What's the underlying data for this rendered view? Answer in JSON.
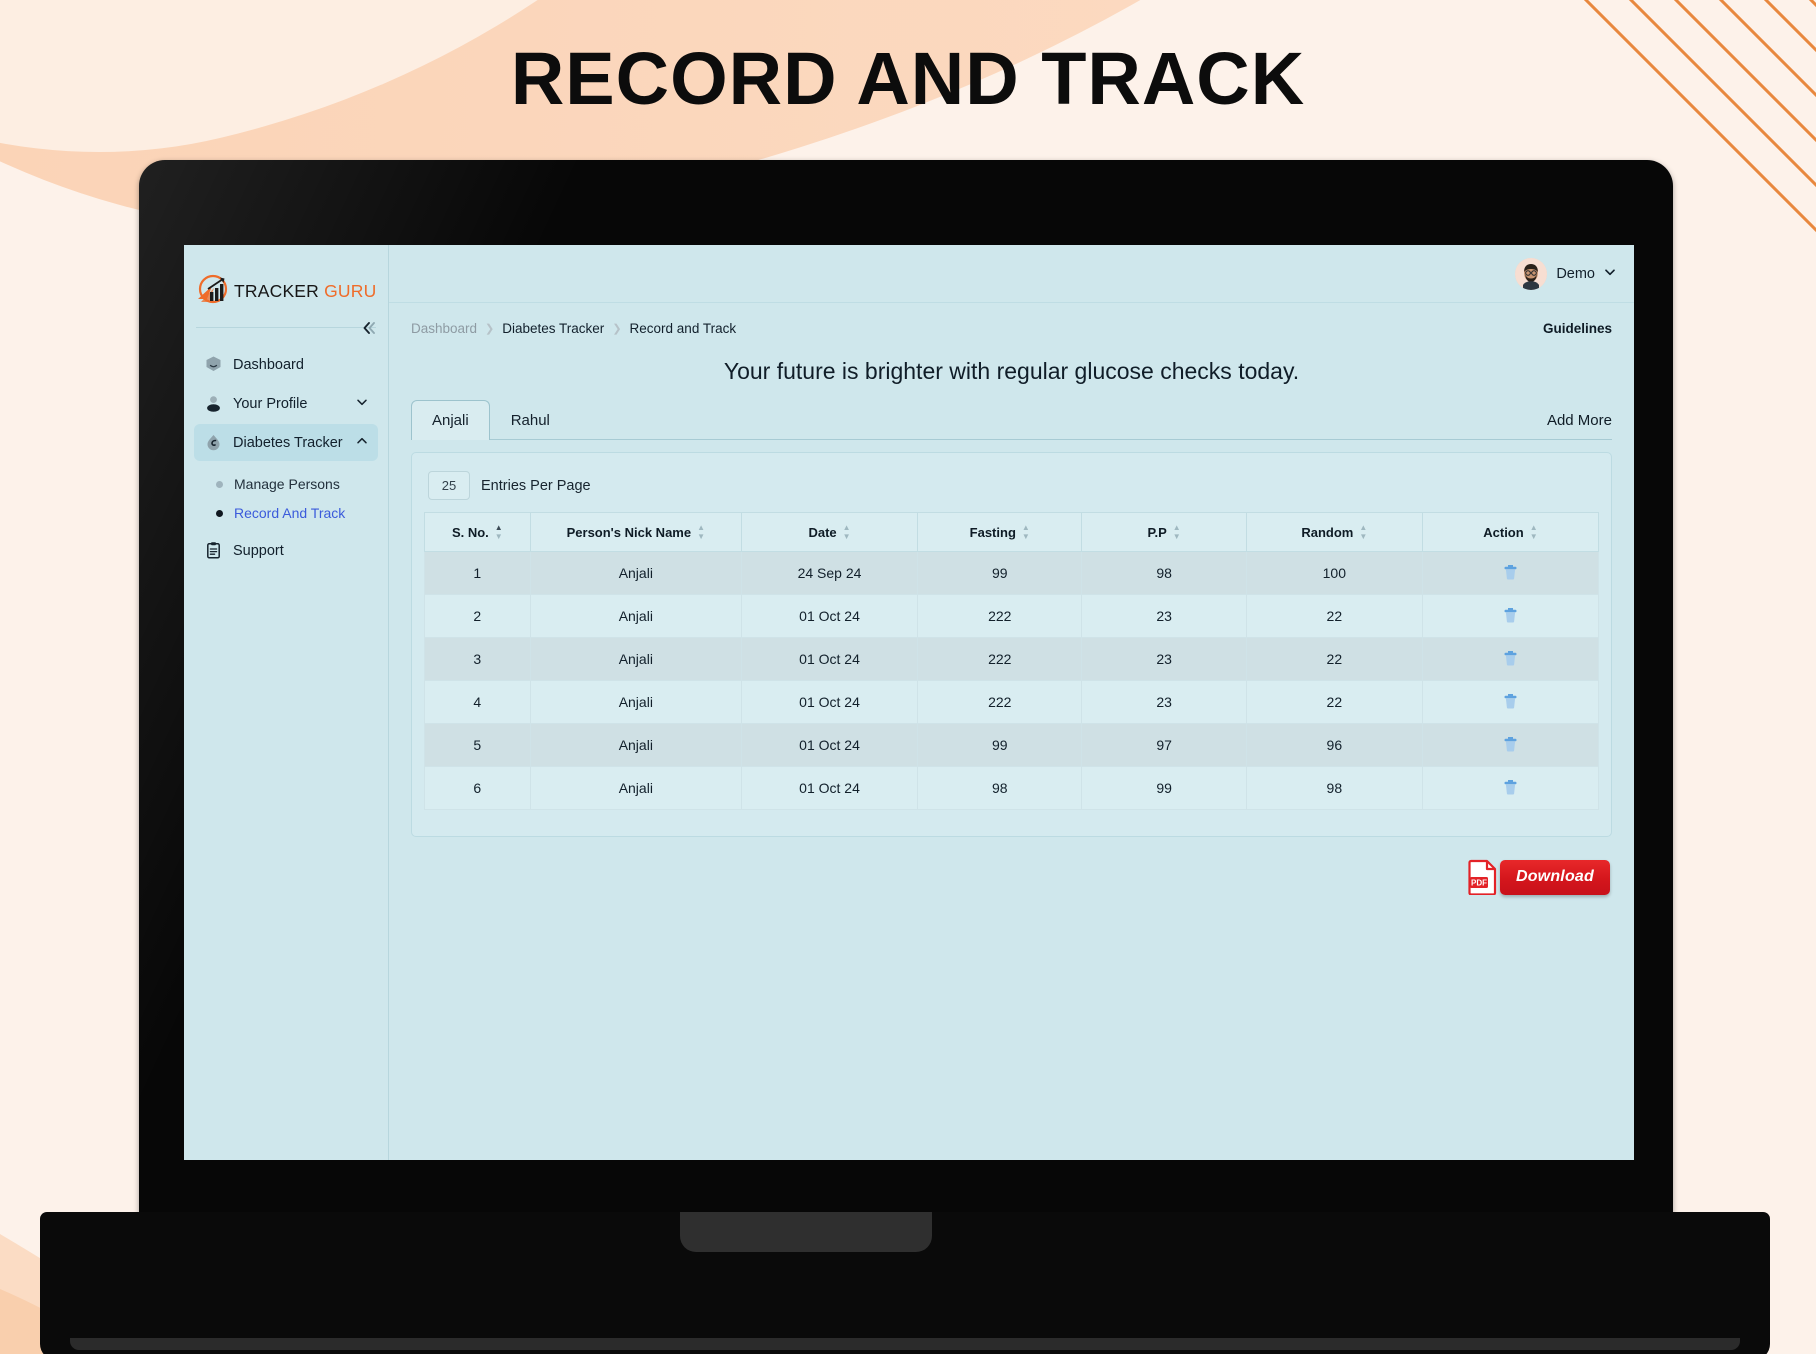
{
  "page": {
    "title": "RECORD AND TRACK"
  },
  "brand": {
    "name": "TRACKER",
    "accent": "GURU",
    "logo_icon": "chart-arrow-logo-icon"
  },
  "sidebar": {
    "collapse_icon": "double-chevron-left-icon",
    "items": [
      {
        "label": "Dashboard",
        "icon": "dashboard-icon",
        "caret": "",
        "active": false
      },
      {
        "label": "Your Profile",
        "icon": "user-icon",
        "caret": "⌄",
        "active": false
      },
      {
        "label": "Diabetes Tracker",
        "icon": "droplet-icon",
        "caret": "⌃",
        "active": true
      },
      {
        "label": "Support",
        "icon": "clipboard-icon",
        "caret": "",
        "active": false
      }
    ],
    "subitems": [
      {
        "label": "Manage Persons",
        "selected": false
      },
      {
        "label": "Record And Track",
        "selected": true
      }
    ]
  },
  "topbar": {
    "user_name": "Demo",
    "caret_icon": "chevron-down-icon",
    "avatar_icon": "avatar-bearded-man-icon"
  },
  "breadcrumb": {
    "items": [
      "Dashboard",
      "Diabetes Tracker",
      "Record and Track"
    ],
    "separator": "❯"
  },
  "guidelines_label": "Guidelines",
  "headline": "Your future is brighter with regular glucose checks today.",
  "tabs": [
    {
      "label": "Anjali",
      "active": true
    },
    {
      "label": "Rahul",
      "active": false
    }
  ],
  "add_more_label": "Add More",
  "entries": {
    "value": "25",
    "label": "Entries Per Page"
  },
  "table": {
    "columns": [
      {
        "label": "S. No.",
        "sort": "asc"
      },
      {
        "label": "Person's Nick Name",
        "sort": "none"
      },
      {
        "label": "Date",
        "sort": "none"
      },
      {
        "label": "Fasting",
        "sort": "none"
      },
      {
        "label": "P.P",
        "sort": "none"
      },
      {
        "label": "Random",
        "sort": "none"
      },
      {
        "label": "Action",
        "sort": "none"
      }
    ],
    "rows": [
      {
        "sno": "1",
        "name": "Anjali",
        "date": "24 Sep 24",
        "fasting": "99",
        "pp": "98",
        "random": "100",
        "action_icon": "trash-icon"
      },
      {
        "sno": "2",
        "name": "Anjali",
        "date": "01 Oct 24",
        "fasting": "222",
        "pp": "23",
        "random": "22",
        "action_icon": "trash-icon"
      },
      {
        "sno": "3",
        "name": "Anjali",
        "date": "01 Oct 24",
        "fasting": "222",
        "pp": "23",
        "random": "22",
        "action_icon": "trash-icon"
      },
      {
        "sno": "4",
        "name": "Anjali",
        "date": "01 Oct 24",
        "fasting": "222",
        "pp": "23",
        "random": "22",
        "action_icon": "trash-icon"
      },
      {
        "sno": "5",
        "name": "Anjali",
        "date": "01 Oct 24",
        "fasting": "99",
        "pp": "97",
        "random": "96",
        "action_icon": "trash-icon"
      },
      {
        "sno": "6",
        "name": "Anjali",
        "date": "01 Oct 24",
        "fasting": "98",
        "pp": "99",
        "random": "98",
        "action_icon": "trash-icon"
      }
    ]
  },
  "download": {
    "label": "Download",
    "file_type": "PDF",
    "icon": "pdf-file-icon"
  },
  "colors": {
    "accent_orange": "#ef6c2a",
    "screen_bg": "#cfe7ec",
    "panel_bg": "#d4eaef",
    "row_alt_bg": "#cfe0e4",
    "link_blue": "#3b5bdb",
    "download_red": "#d4161c",
    "page_bg": "#fdf2ea",
    "peach": "#fbd2b3"
  }
}
